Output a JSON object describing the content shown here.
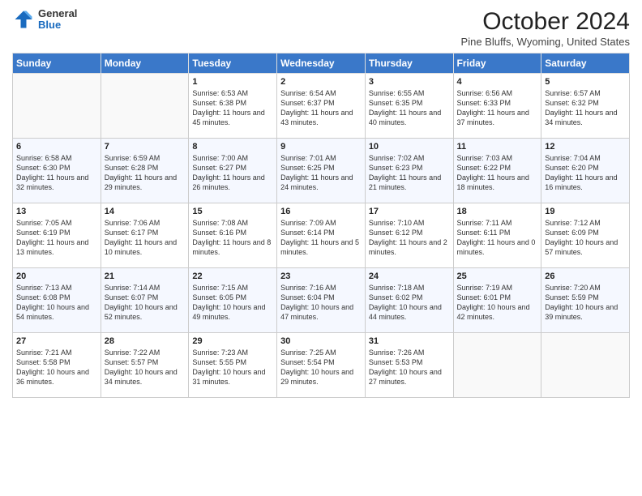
{
  "logo": {
    "general": "General",
    "blue": "Blue"
  },
  "header": {
    "month": "October 2024",
    "location": "Pine Bluffs, Wyoming, United States"
  },
  "weekdays": [
    "Sunday",
    "Monday",
    "Tuesday",
    "Wednesday",
    "Thursday",
    "Friday",
    "Saturday"
  ],
  "weeks": [
    [
      {
        "day": "",
        "info": ""
      },
      {
        "day": "",
        "info": ""
      },
      {
        "day": "1",
        "info": "Sunrise: 6:53 AM\nSunset: 6:38 PM\nDaylight: 11 hours and 45 minutes."
      },
      {
        "day": "2",
        "info": "Sunrise: 6:54 AM\nSunset: 6:37 PM\nDaylight: 11 hours and 43 minutes."
      },
      {
        "day": "3",
        "info": "Sunrise: 6:55 AM\nSunset: 6:35 PM\nDaylight: 11 hours and 40 minutes."
      },
      {
        "day": "4",
        "info": "Sunrise: 6:56 AM\nSunset: 6:33 PM\nDaylight: 11 hours and 37 minutes."
      },
      {
        "day": "5",
        "info": "Sunrise: 6:57 AM\nSunset: 6:32 PM\nDaylight: 11 hours and 34 minutes."
      }
    ],
    [
      {
        "day": "6",
        "info": "Sunrise: 6:58 AM\nSunset: 6:30 PM\nDaylight: 11 hours and 32 minutes."
      },
      {
        "day": "7",
        "info": "Sunrise: 6:59 AM\nSunset: 6:28 PM\nDaylight: 11 hours and 29 minutes."
      },
      {
        "day": "8",
        "info": "Sunrise: 7:00 AM\nSunset: 6:27 PM\nDaylight: 11 hours and 26 minutes."
      },
      {
        "day": "9",
        "info": "Sunrise: 7:01 AM\nSunset: 6:25 PM\nDaylight: 11 hours and 24 minutes."
      },
      {
        "day": "10",
        "info": "Sunrise: 7:02 AM\nSunset: 6:23 PM\nDaylight: 11 hours and 21 minutes."
      },
      {
        "day": "11",
        "info": "Sunrise: 7:03 AM\nSunset: 6:22 PM\nDaylight: 11 hours and 18 minutes."
      },
      {
        "day": "12",
        "info": "Sunrise: 7:04 AM\nSunset: 6:20 PM\nDaylight: 11 hours and 16 minutes."
      }
    ],
    [
      {
        "day": "13",
        "info": "Sunrise: 7:05 AM\nSunset: 6:19 PM\nDaylight: 11 hours and 13 minutes."
      },
      {
        "day": "14",
        "info": "Sunrise: 7:06 AM\nSunset: 6:17 PM\nDaylight: 11 hours and 10 minutes."
      },
      {
        "day": "15",
        "info": "Sunrise: 7:08 AM\nSunset: 6:16 PM\nDaylight: 11 hours and 8 minutes."
      },
      {
        "day": "16",
        "info": "Sunrise: 7:09 AM\nSunset: 6:14 PM\nDaylight: 11 hours and 5 minutes."
      },
      {
        "day": "17",
        "info": "Sunrise: 7:10 AM\nSunset: 6:12 PM\nDaylight: 11 hours and 2 minutes."
      },
      {
        "day": "18",
        "info": "Sunrise: 7:11 AM\nSunset: 6:11 PM\nDaylight: 11 hours and 0 minutes."
      },
      {
        "day": "19",
        "info": "Sunrise: 7:12 AM\nSunset: 6:09 PM\nDaylight: 10 hours and 57 minutes."
      }
    ],
    [
      {
        "day": "20",
        "info": "Sunrise: 7:13 AM\nSunset: 6:08 PM\nDaylight: 10 hours and 54 minutes."
      },
      {
        "day": "21",
        "info": "Sunrise: 7:14 AM\nSunset: 6:07 PM\nDaylight: 10 hours and 52 minutes."
      },
      {
        "day": "22",
        "info": "Sunrise: 7:15 AM\nSunset: 6:05 PM\nDaylight: 10 hours and 49 minutes."
      },
      {
        "day": "23",
        "info": "Sunrise: 7:16 AM\nSunset: 6:04 PM\nDaylight: 10 hours and 47 minutes."
      },
      {
        "day": "24",
        "info": "Sunrise: 7:18 AM\nSunset: 6:02 PM\nDaylight: 10 hours and 44 minutes."
      },
      {
        "day": "25",
        "info": "Sunrise: 7:19 AM\nSunset: 6:01 PM\nDaylight: 10 hours and 42 minutes."
      },
      {
        "day": "26",
        "info": "Sunrise: 7:20 AM\nSunset: 5:59 PM\nDaylight: 10 hours and 39 minutes."
      }
    ],
    [
      {
        "day": "27",
        "info": "Sunrise: 7:21 AM\nSunset: 5:58 PM\nDaylight: 10 hours and 36 minutes."
      },
      {
        "day": "28",
        "info": "Sunrise: 7:22 AM\nSunset: 5:57 PM\nDaylight: 10 hours and 34 minutes."
      },
      {
        "day": "29",
        "info": "Sunrise: 7:23 AM\nSunset: 5:55 PM\nDaylight: 10 hours and 31 minutes."
      },
      {
        "day": "30",
        "info": "Sunrise: 7:25 AM\nSunset: 5:54 PM\nDaylight: 10 hours and 29 minutes."
      },
      {
        "day": "31",
        "info": "Sunrise: 7:26 AM\nSunset: 5:53 PM\nDaylight: 10 hours and 27 minutes."
      },
      {
        "day": "",
        "info": ""
      },
      {
        "day": "",
        "info": ""
      }
    ]
  ]
}
